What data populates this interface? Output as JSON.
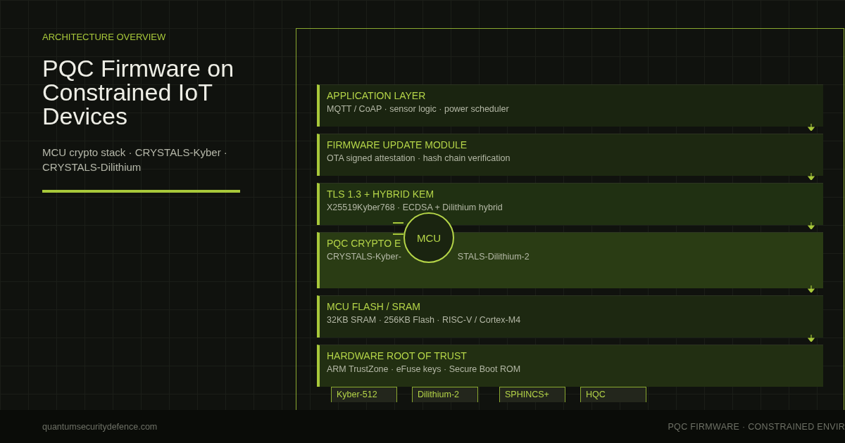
{
  "eyebrow": "ARCHITECTURE OVERVIEW",
  "title": "PQC Firmware on Constrained IoT Devices",
  "subtitle": "MCU crypto stack · CRYSTALS-Kyber · CRYSTALS-Dilithium",
  "layers": [
    {
      "kind": "layer",
      "title": "APPLICATION LAYER",
      "detail": [
        "MQTT / CoAP · sensor logic · power scheduler"
      ]
    },
    {
      "kind": "layer",
      "title": "FIRMWARE UPDATE MODULE",
      "detail": [
        "OTA signed attestation · hash chain verification"
      ]
    },
    {
      "kind": "layer",
      "title": "TLS 1.3 + HYBRID KEM",
      "detail": [
        "X25519Kyber768 · ECDSA + Dilithium hybrid"
      ]
    },
    {
      "kind": "core",
      "title": "PQC CRYPTO E",
      "detail": [
        "CRYSTALS-Kyber-",
        "STALS-Dilithium-2"
      ],
      "chip_label": "MCU"
    },
    {
      "kind": "layer",
      "title": "MCU FLASH / SRAM",
      "detail": [
        "32KB SRAM · 256KB Flash · RISC-V / Cortex-M4"
      ]
    },
    {
      "kind": "layer",
      "title": "HARDWARE ROOT OF TRUST",
      "detail": [
        "ARM TrustZone · eFuse keys · Secure Boot ROM"
      ]
    }
  ],
  "algorithms": [
    "Kyber-512",
    "Dilithium-2",
    "SPHINCS+",
    "HQC"
  ],
  "footer": {
    "site": "quantumsecuritydefence.com",
    "tagline": "PQC FIRMWARE · CONSTRAINED ENVIR"
  }
}
